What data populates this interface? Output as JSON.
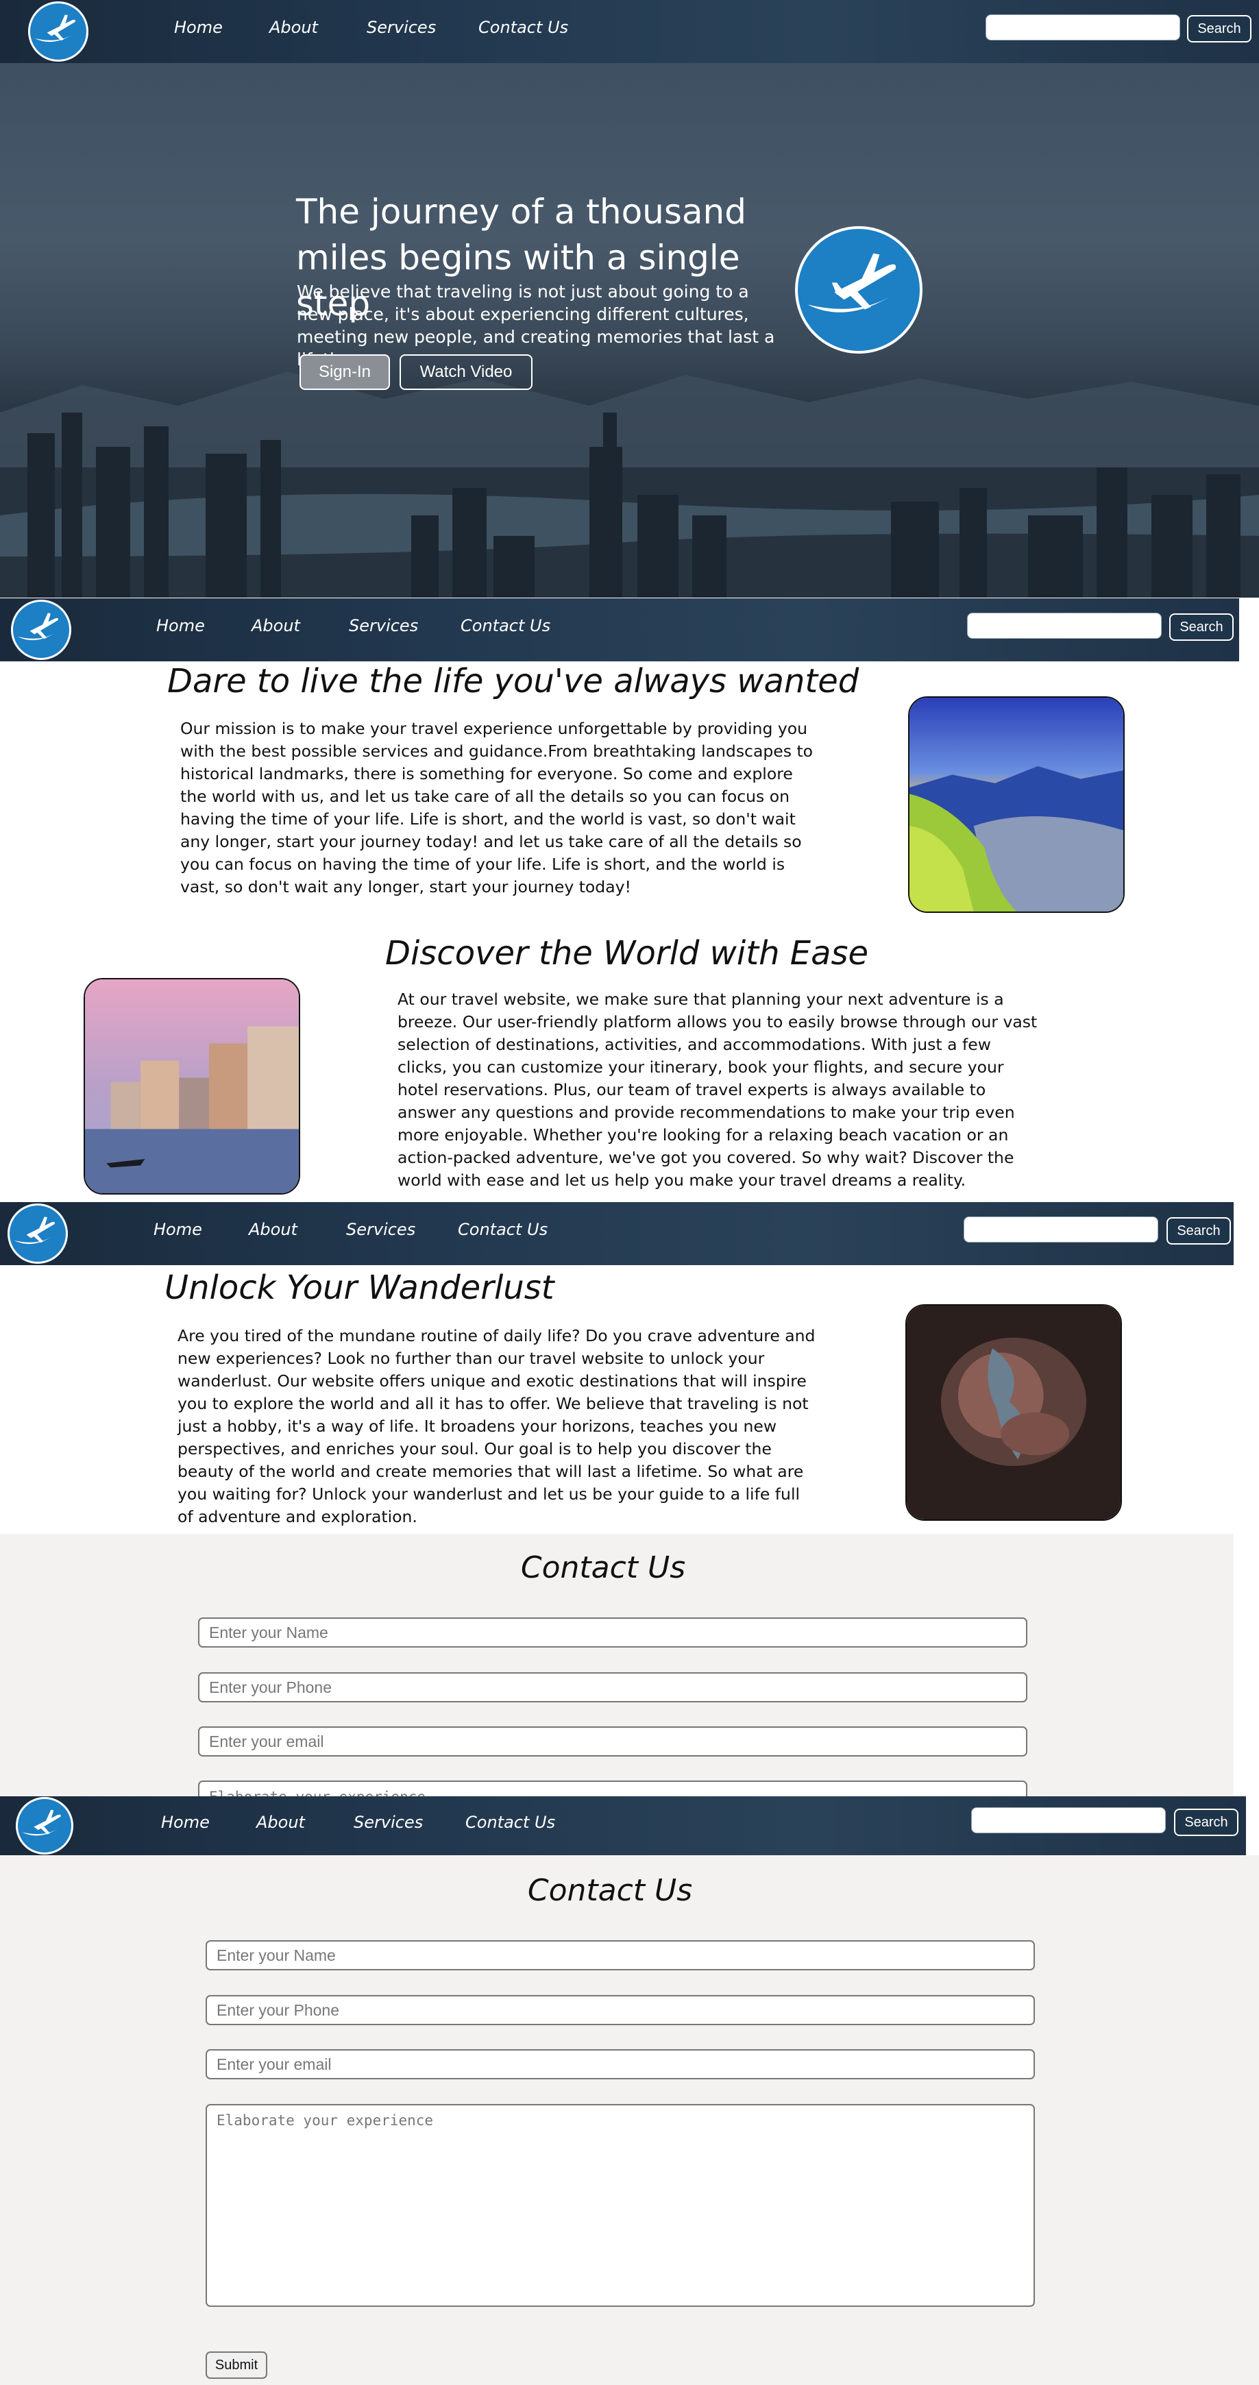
{
  "nav": {
    "links": [
      "Home",
      "About",
      "Services",
      "Contact Us"
    ],
    "search_button": "Search",
    "search_value": ""
  },
  "hero": {
    "title": "The journey of a thousand miles begins with a single step",
    "text": "We believe that traveling is not just about going to a new place, it's about experiencing different cultures, meeting new people, and creating memories that last a lifetime.",
    "signin_button": "Sign-In",
    "watch_button": "Watch Video"
  },
  "section1": {
    "title": "Dare to live the life you've always wanted",
    "text": "Our mission is to make your travel experience unforgettable by providing you with the best possible services and guidance.From breathtaking landscapes to historical landmarks, there is something for everyone. So come and explore the world with us, and let us take care of all the details so you can focus on having the time of your life. Life is short, and the world is vast, so don't wait any longer, start your journey today! and let us take care of all the details so you can focus on having the time of your life. Life is short, and the world is vast, so don't wait any longer, start your journey today!"
  },
  "section2": {
    "title": "Discover the World with Ease",
    "text": "At our travel website, we make sure that planning your next adventure is a breeze. Our user-friendly platform allows you to easily browse through our vast selection of destinations, activities, and accommodations. With just a few clicks, you can customize your itinerary, book your flights, and secure your hotel reservations. Plus, our team of travel experts is always available to answer any questions and provide recommendations to make your trip even more enjoyable. Whether you're looking for a relaxing beach vacation or an action-packed adventure, we've got you covered. So why wait? Discover the world with ease and let us help you make your travel dreams a reality."
  },
  "section3": {
    "title": "Unlock Your Wanderlust",
    "text": "Are you tired of the mundane routine of daily life? Do you crave adventure and new experiences? Look no further than our travel website to unlock your wanderlust. Our website offers unique and exotic destinations that will inspire you to explore the world and all it has to offer. We believe that traveling is not just a hobby, it's a way of life. It broadens your horizons, teaches you new perspectives, and enriches your soul. Our goal is to help you discover the beauty of the world and create memories that will last a lifetime. So what are you waiting for? Unlock your wanderlust and let us be your guide to a life full of adventure and exploration."
  },
  "contact": {
    "title": "Contact Us",
    "name_placeholder": "Enter your Name",
    "phone_placeholder": "Enter your Phone",
    "email_placeholder": "Enter your email",
    "experience_placeholder": "Elaborate your experience",
    "submit_label": "Submit"
  },
  "colors": {
    "logo_blue": "#1d7fc4",
    "nav_bg": "#22384f",
    "contact_bg": "#f4f2f1"
  }
}
